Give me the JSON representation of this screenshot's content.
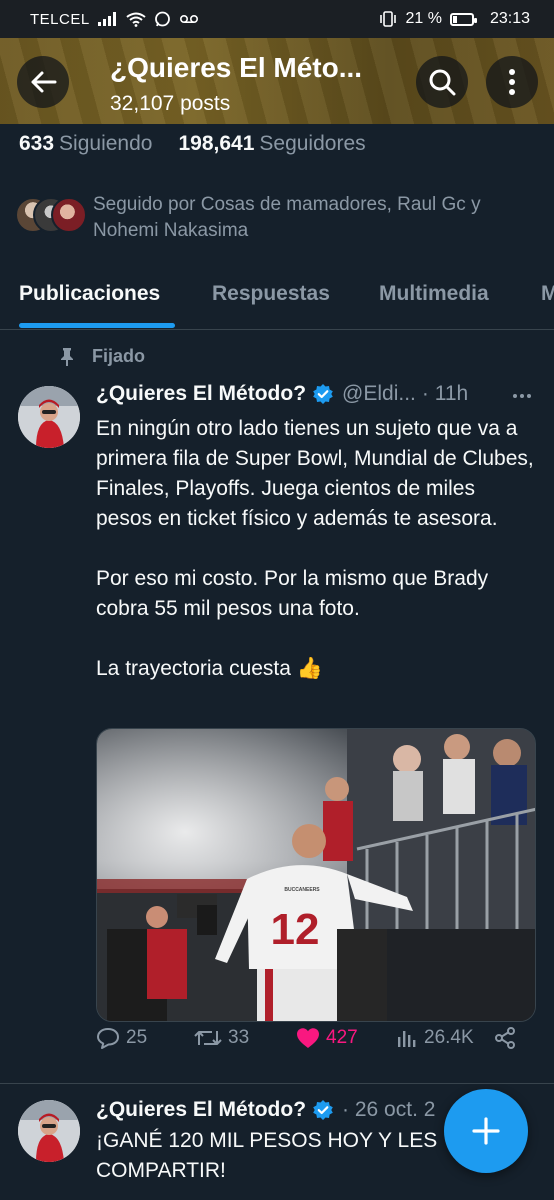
{
  "status_bar": {
    "carrier": "TELCEL",
    "battery": "21 %",
    "battery_level": 0.21,
    "time": "23:13"
  },
  "header": {
    "title": "¿Quieres El Méto...",
    "posts": "32,107 posts",
    "back_icon": "arrow-left-icon",
    "search_icon": "search-icon",
    "more_icon": "more-vertical-icon"
  },
  "profile": {
    "following_count": "633",
    "following_label": "Siguiendo",
    "followers_count": "198,641",
    "followers_label": "Seguidores",
    "followed_by": "Seguido por Cosas de mamadores, Raul Gc y Nohemi Nakasima"
  },
  "tabs": [
    {
      "label": "Publicaciones",
      "active": true
    },
    {
      "label": "Respuestas",
      "active": false
    },
    {
      "label": "Multimedia",
      "active": false
    },
    {
      "label": "M",
      "active": false
    }
  ],
  "pinned_post": {
    "pinned_label": "Fijado",
    "author_name": "¿Quieres El Método?",
    "handle": "@Eldi...",
    "time": "· 11h",
    "paragraphs": [
      "En ningún otro lado tienes un sujeto que va a primera fila de Super Bowl, Mundial de Clubes, Finales, Playoffs. Juega cientos de miles pesos en ticket físico y además te asesora.",
      "Por eso mi costo. Por la mismo que Brady cobra 55 mil pesos una foto.",
      "La trayectoria cuesta 👍"
    ],
    "image_text": {
      "jersey_number": "12",
      "jersey_brand": "BUCCANEERS"
    },
    "replies": "25",
    "reposts": "33",
    "likes": "427",
    "views": "26.4K",
    "liked": true
  },
  "second_post": {
    "author_name": "¿Quieres El Método?",
    "time": "· 26 oct. 2",
    "text": "¡GANÉ 120 MIL PESOS HOY Y LES COMPARTIR!"
  },
  "colors": {
    "background": "#15202b",
    "accent": "#1d9bf0",
    "like": "#f91880",
    "muted": "#8b98a5"
  }
}
